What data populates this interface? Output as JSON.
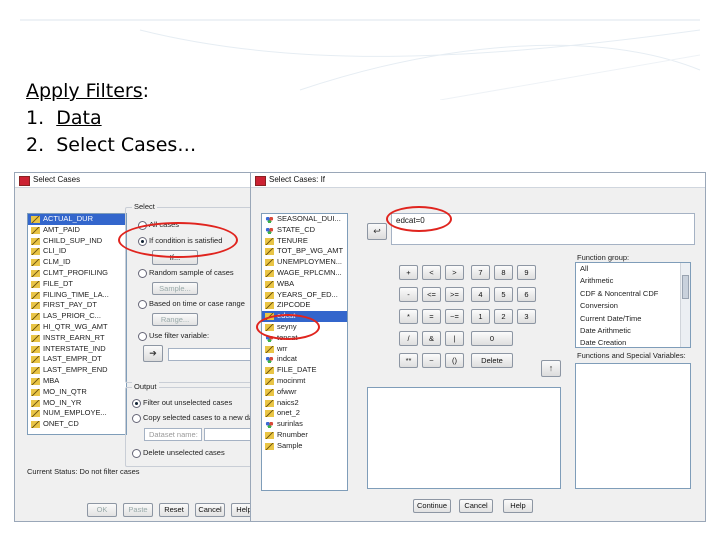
{
  "slide": {
    "title": "Apply Filters",
    "title_colon": ":",
    "steps": [
      {
        "num": "1.",
        "text": "Data"
      },
      {
        "num": "2.",
        "text": "Select Cases…"
      }
    ]
  },
  "select_cases": {
    "title": "Select Cases",
    "variables": [
      {
        "name": "ACTUAL_DUR",
        "type": "ruler",
        "selected": true
      },
      {
        "name": "AMT_PAID",
        "type": "ruler"
      },
      {
        "name": "CHILD_SUP_IND",
        "type": "ruler"
      },
      {
        "name": "CLI_ID",
        "type": "ruler"
      },
      {
        "name": "CLM_ID",
        "type": "ruler"
      },
      {
        "name": "CLMT_PROFILING",
        "type": "ruler"
      },
      {
        "name": "FILE_DT",
        "type": "ruler"
      },
      {
        "name": "FILING_TIME_LA...",
        "type": "ruler"
      },
      {
        "name": "FIRST_PAY_DT",
        "type": "ruler"
      },
      {
        "name": "LAS_PRIOR_C...",
        "type": "ruler"
      },
      {
        "name": "HI_QTR_WG_AMT",
        "type": "ruler"
      },
      {
        "name": "INSTR_EARN_RT",
        "type": "ruler"
      },
      {
        "name": "INTERSTATE_IND",
        "type": "ruler"
      },
      {
        "name": "LAST_EMPR_DT",
        "type": "ruler"
      },
      {
        "name": "LAST_EMPR_END",
        "type": "ruler"
      },
      {
        "name": "MBA",
        "type": "ruler"
      },
      {
        "name": "MO_IN_QTR",
        "type": "ruler"
      },
      {
        "name": "MO_IN_YR",
        "type": "ruler"
      },
      {
        "name": "NUM_EMPLOYE...",
        "type": "ruler"
      },
      {
        "name": "ONET_CD",
        "type": "ruler"
      }
    ],
    "select_group_label": "Select",
    "options": {
      "all_cases": "All cases",
      "if_condition": "If condition is satisfied",
      "if_button": "If...",
      "random_sample": "Random sample of cases",
      "sample_button": "Sample...",
      "based_on_range": "Based on time or case range",
      "range_button": "Range...",
      "use_filter": "Use filter variable:"
    },
    "output_group_label": "Output",
    "output_options": {
      "filter_out": "Filter out unselected cases",
      "copy_selected": "Copy selected cases to a new dataset",
      "dataset_name_placeholder": "Dataset name:",
      "delete_unselected": "Delete unselected cases"
    },
    "status": "Current Status: Do not filter cases",
    "buttons": {
      "ok": "OK",
      "paste": "Paste",
      "reset": "Reset",
      "cancel": "Cancel",
      "help": "Help"
    }
  },
  "if_dialog": {
    "title": "Select Cases: If",
    "variables": [
      {
        "name": "SEASONAL_DUI...",
        "type": "nominal"
      },
      {
        "name": "STATE_CD",
        "type": "nominal"
      },
      {
        "name": "TENURE",
        "type": "ruler"
      },
      {
        "name": "TOT_BP_WG_AMT",
        "type": "ruler"
      },
      {
        "name": "UNEMPLOYMEN...",
        "type": "ruler"
      },
      {
        "name": "WAGE_RPLCMN...",
        "type": "ruler"
      },
      {
        "name": "WBA",
        "type": "ruler"
      },
      {
        "name": "YEARS_OF_ED...",
        "type": "ruler"
      },
      {
        "name": "ZIPCODE",
        "type": "ruler"
      },
      {
        "name": "edcat",
        "type": "ruler",
        "selected": true
      },
      {
        "name": "seyny",
        "type": "ruler"
      },
      {
        "name": "tencat",
        "type": "nominal"
      },
      {
        "name": "wrr",
        "type": "ruler"
      },
      {
        "name": "indcat",
        "type": "nominal"
      },
      {
        "name": "FILE_DATE",
        "type": "ruler"
      },
      {
        "name": "mocinmt",
        "type": "ruler"
      },
      {
        "name": "ofwwr",
        "type": "ruler"
      },
      {
        "name": "naics2",
        "type": "ruler"
      },
      {
        "name": "onet_2",
        "type": "ruler"
      },
      {
        "name": "surinlas",
        "type": "nominal"
      },
      {
        "name": "Rnumber",
        "type": "ruler"
      },
      {
        "name": "Sample",
        "type": "ruler"
      }
    ],
    "expression": "edcat=0",
    "keys": [
      "+",
      "<",
      ">",
      "7",
      "8",
      "9",
      "-",
      "<=",
      ">=",
      "4",
      "5",
      "6",
      "*",
      "=",
      "~=",
      "1",
      "2",
      "3",
      "/",
      "&",
      "|",
      "0",
      "**",
      "~",
      "()",
      "Delete"
    ],
    "function_group_label": "Function group:",
    "function_groups": [
      "All",
      "Arithmetic",
      "CDF & Noncentral CDF",
      "Conversion",
      "Current Date/Time",
      "Date Arithmetic",
      "Date Creation"
    ],
    "functions_label": "Functions and Special Variables:",
    "buttons": {
      "continue": "Continue",
      "cancel": "Cancel",
      "help": "Help"
    }
  }
}
